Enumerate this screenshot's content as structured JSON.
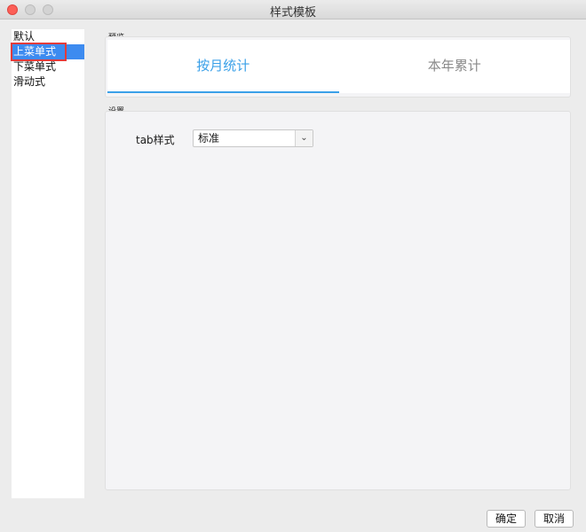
{
  "window": {
    "title": "样式模板"
  },
  "sidebar": {
    "items": [
      {
        "label": "默认"
      },
      {
        "label": "上菜单式"
      },
      {
        "label": "下菜单式"
      },
      {
        "label": "滑动式"
      }
    ],
    "selected_index": 1
  },
  "preview": {
    "group_label": "预览",
    "tabs": [
      {
        "label": "按月统计"
      },
      {
        "label": "本年累计"
      }
    ],
    "active_tab": 0
  },
  "settings": {
    "group_label": "设置",
    "tab_style_label": "tab样式",
    "tab_style_value": "标准"
  },
  "buttons": {
    "ok_label": "确定",
    "cancel_label": "取消"
  },
  "colors": {
    "accent": "#3aa0e8",
    "selection": "#3d8bf0",
    "highlight_box": "#e23b3b"
  }
}
